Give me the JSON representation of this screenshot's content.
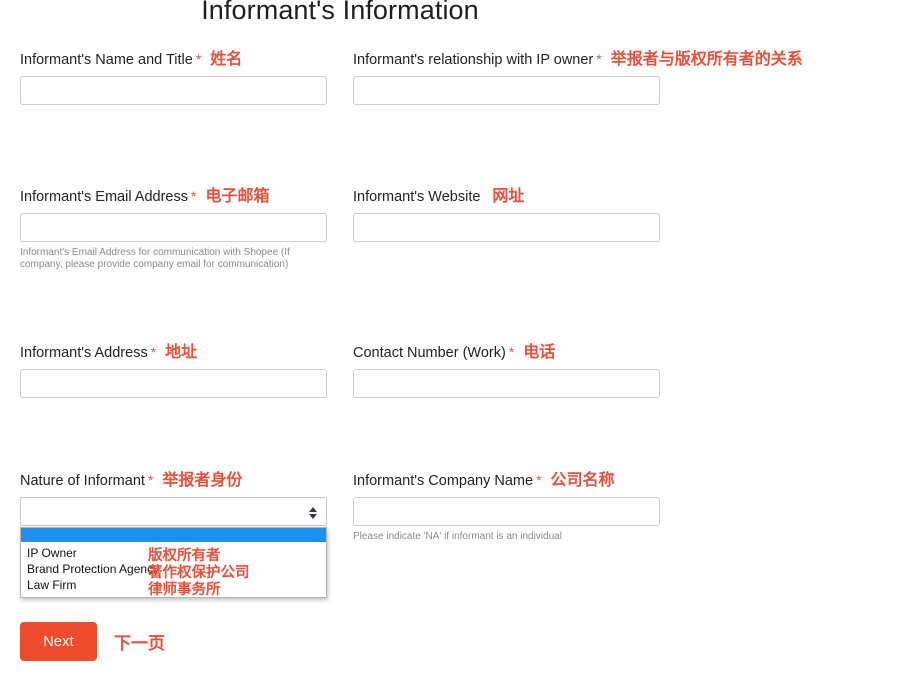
{
  "page": {
    "title": "Informant's Information",
    "accent_color": "#ee4d2d",
    "annotation_color": "#e8503a",
    "background_color": "#ffffff"
  },
  "fields": {
    "name_title": {
      "label": "Informant's Name and Title",
      "required_mark": "*",
      "annotation": "姓名",
      "value": "",
      "placeholder": ""
    },
    "relationship": {
      "label": "Informant's relationship with IP owner",
      "required_mark": "*",
      "annotation": "举报者与版权所有者的关系",
      "value": "",
      "placeholder": ""
    },
    "email": {
      "label": "Informant's Email Address",
      "required_mark": "*",
      "annotation": "电子邮箱",
      "value": "",
      "placeholder": "",
      "helper": "Informant's Email Address for communication with Shopee (If company, please provide company email for communication)"
    },
    "website": {
      "label": "Informant's Website",
      "required_mark": "",
      "annotation": "网址",
      "value": "",
      "placeholder": ""
    },
    "address": {
      "label": "Informant's Address",
      "required_mark": "*",
      "annotation": "地址",
      "value": "",
      "placeholder": ""
    },
    "contact_number": {
      "label": "Contact Number (Work)",
      "required_mark": "*",
      "annotation": "电话",
      "value": "",
      "placeholder": ""
    },
    "nature_of_informant": {
      "label": "Nature of Informant",
      "required_mark": "*",
      "annotation": "举报者身份",
      "selected_value": "",
      "expanded": true,
      "options": [
        {
          "label": "",
          "annotation": "",
          "highlighted": true
        },
        {
          "label": "IP Owner",
          "annotation": "版权所有者",
          "highlighted": false
        },
        {
          "label": "Brand Protection Agency",
          "annotation": "著作权保护公司",
          "highlighted": false
        },
        {
          "label": "Law Firm",
          "annotation": "律师事务所",
          "highlighted": false
        }
      ]
    },
    "company_name": {
      "label": "Informant's Company Name",
      "required_mark": "*",
      "annotation": "公司名称",
      "value": "",
      "placeholder": "",
      "helper": "Please indicate 'NA' if informant is an individual"
    }
  },
  "footer": {
    "next_label": "Next",
    "next_annotation": "下一页"
  }
}
